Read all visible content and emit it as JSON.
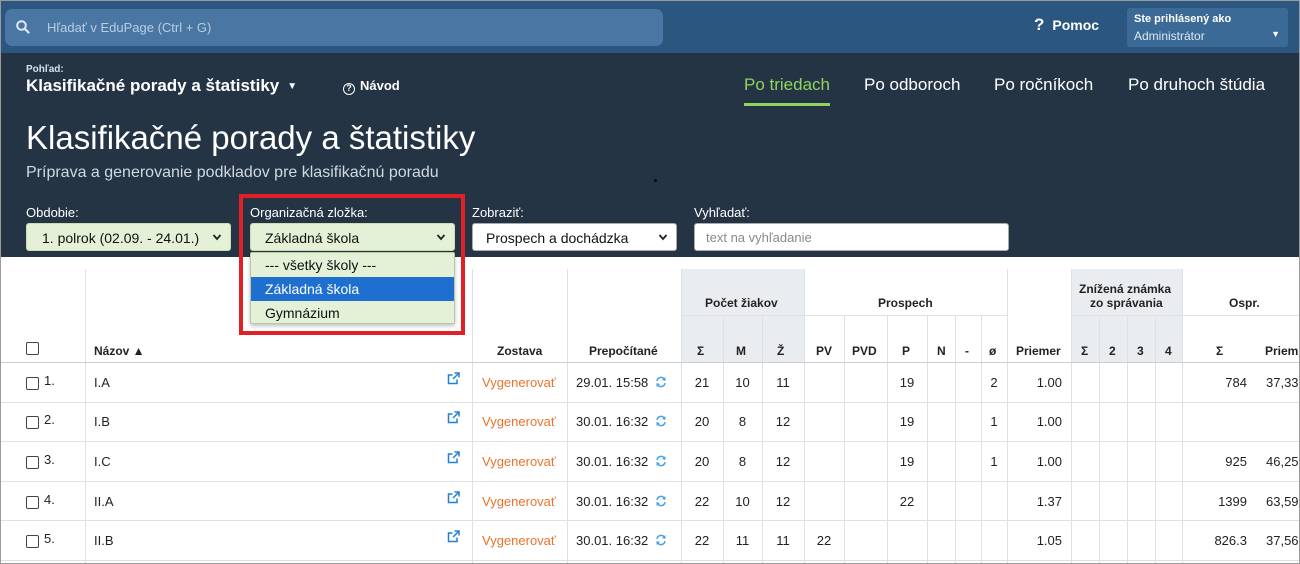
{
  "topbar": {
    "search_placeholder": "Hľadať v EduPage (Ctrl + G)",
    "help_label": "Pomoc",
    "user_line1": "Ste prihlásený ako",
    "user_line2": "Administrátor"
  },
  "header": {
    "view_caption": "Pohľad:",
    "view_name": "Klasifikačné porady a štatistiky",
    "navod": "Návod",
    "tabs": [
      "Po triedach",
      "Po odboroch",
      "Po ročníkoch",
      "Po druhoch štúdia"
    ],
    "active_tab": "Po triedach",
    "title": "Klasifikačné porady a štatistiky",
    "subtitle": "Príprava a generovanie podkladov pre klasifikačnú poradu"
  },
  "filters": {
    "obdobie_label": "Obdobie:",
    "obdobie_value": "1. polrok (02.09. - 24.01.)",
    "org_label": "Organizačná zložka:",
    "org_value": "Základná škola",
    "zobrazit_label": "Zobraziť:",
    "zobrazit_value": "Prospech a dochádzka",
    "vyhladat_label": "Vyhľadať:",
    "vyhladat_placeholder": "text na vyhľadanie"
  },
  "dropdown": {
    "options": [
      "--- všetky školy ---",
      "Základná škola",
      "Gymnázium"
    ],
    "selected": "Základná škola"
  },
  "table": {
    "headers": {
      "nazov": "Názov ▲",
      "zostava": "Zostava",
      "prepocitane": "Prepočítané",
      "pocet_ziakov": "Počet žiakov",
      "prospech": "Prospech",
      "znizena_1": "Znížená známka",
      "znizena_2": "zo správania",
      "ospr": "Ospr.",
      "sigma": "Σ",
      "m": "M",
      "z": "Ž",
      "pv": "PV",
      "pvd": "PVD",
      "p": "P",
      "n": "N",
      "dash": "-",
      "slash0": "ø",
      "priemer": "Priemer",
      "z2": "2",
      "z3": "3",
      "z4": "4",
      "priem": "Priem."
    },
    "rows": [
      {
        "no": "1.",
        "name": "I.A",
        "gen": "Vygenerovať",
        "date": "29.01. 15:58",
        "sum": "21",
        "m": "10",
        "z": "11",
        "pv": "",
        "pvd": "",
        "p": "19",
        "n": "",
        "dash": "",
        "slash0": "2",
        "avg": "1.00",
        "ospr": "784",
        "ospr_avg": "37,33"
      },
      {
        "no": "2.",
        "name": "I.B",
        "gen": "Vygenerovať",
        "date": "30.01. 16:32",
        "sum": "20",
        "m": "8",
        "z": "12",
        "pv": "",
        "pvd": "",
        "p": "19",
        "n": "",
        "dash": "",
        "slash0": "1",
        "avg": "1.00",
        "ospr": "",
        "ospr_avg": ""
      },
      {
        "no": "3.",
        "name": "I.C",
        "gen": "Vygenerovať",
        "date": "30.01. 16:32",
        "sum": "20",
        "m": "8",
        "z": "12",
        "pv": "",
        "pvd": "",
        "p": "19",
        "n": "",
        "dash": "",
        "slash0": "1",
        "avg": "1.00",
        "ospr": "925",
        "ospr_avg": "46,25"
      },
      {
        "no": "4.",
        "name": "II.A",
        "gen": "Vygenerovať",
        "date": "30.01. 16:32",
        "sum": "22",
        "m": "10",
        "z": "12",
        "pv": "",
        "pvd": "",
        "p": "22",
        "n": "",
        "dash": "",
        "slash0": "",
        "avg": "1.37",
        "ospr": "1399",
        "ospr_avg": "63,59"
      },
      {
        "no": "5.",
        "name": "II.B",
        "gen": "Vygenerovať",
        "date": "30.01. 16:32",
        "sum": "22",
        "m": "11",
        "z": "11",
        "pv": "22",
        "pvd": "",
        "p": "",
        "n": "",
        "dash": "",
        "slash0": "",
        "avg": "1.05",
        "ospr": "826.3",
        "ospr_avg": "37,56"
      }
    ]
  },
  "colors": {
    "topbar": "#2a5680",
    "header": "#243445",
    "active_tab": "#8fd45f",
    "generate": "#e8732a",
    "highlight_box": "#e01f26",
    "selected_option": "#1e6fd0"
  }
}
